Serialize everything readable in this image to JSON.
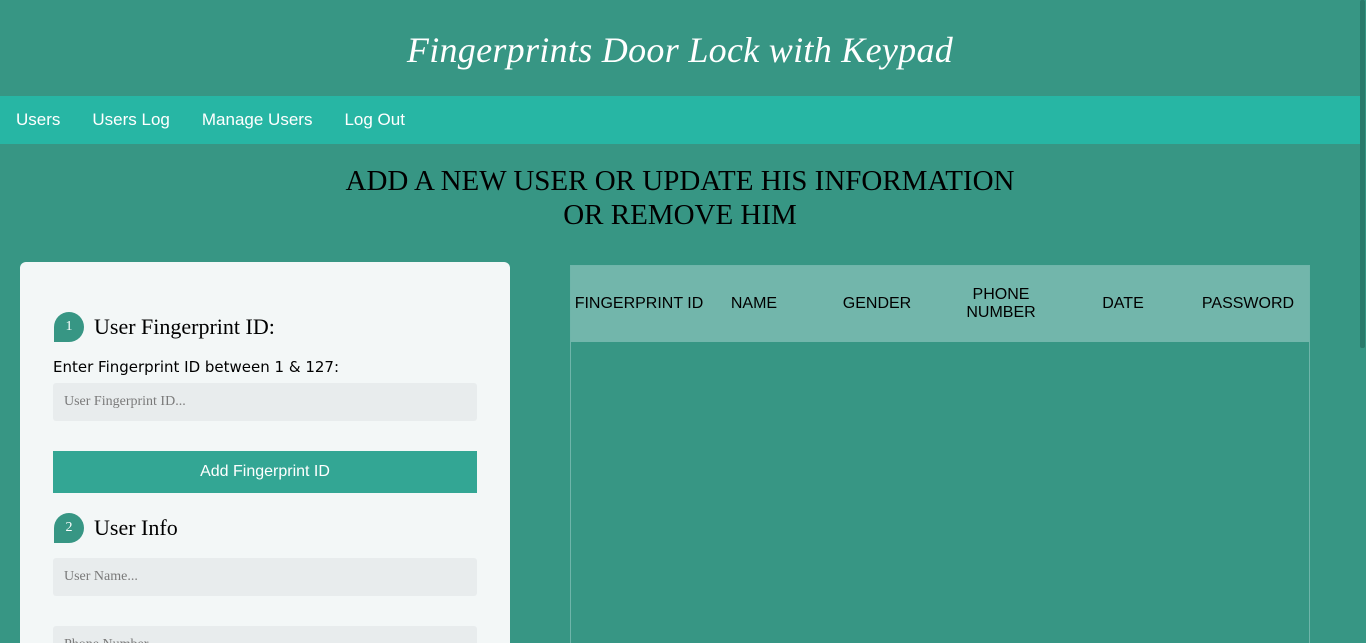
{
  "header": {
    "title": "Fingerprints Door Lock with Keypad"
  },
  "nav": {
    "items": [
      "Users",
      "Users Log",
      "Manage Users",
      "Log Out"
    ]
  },
  "page": {
    "heading_line1": "ADD A NEW USER OR UPDATE HIS INFORMATION",
    "heading_line2": "OR REMOVE HIM"
  },
  "form": {
    "step1": {
      "number": "1",
      "title": "User Fingerprint ID:",
      "label": "Enter Fingerprint ID between 1 & 127:",
      "placeholder": "User Fingerprint ID...",
      "button_label": "Add Fingerprint ID"
    },
    "step2": {
      "number": "2",
      "title": "User Info",
      "name_placeholder": "User Name...",
      "phone_placeholder": "Phone Number..."
    }
  },
  "table": {
    "columns": [
      "FINGERPRINT ID",
      "NAME",
      "GENDER",
      "PHONE NUMBER",
      "DATE",
      "PASSWORD"
    ],
    "rows": []
  },
  "colors": {
    "background": "#379684",
    "navbar": "#27b6a4",
    "card": "#f3f7f7",
    "accent": "#33a694",
    "table_header": "#72b6ab"
  }
}
